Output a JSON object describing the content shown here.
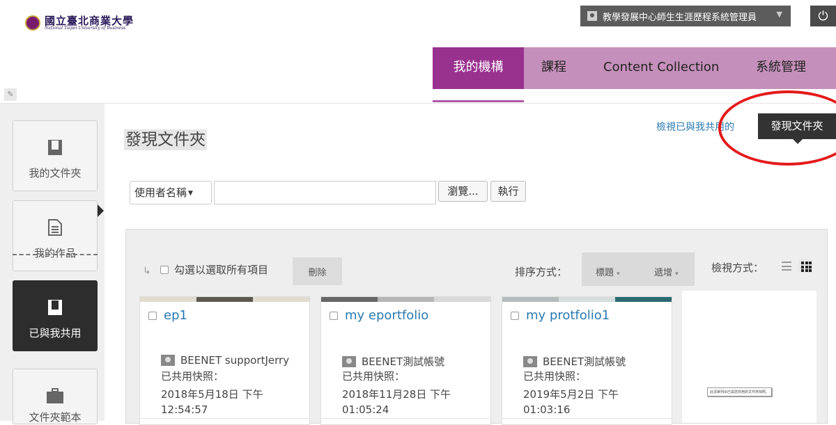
{
  "header": {
    "logo_cn": "國立臺北商業大學",
    "logo_en": "National Taipei University of Business",
    "user_name": "教學發展中心師生生涯歷程系統管理員"
  },
  "nav": {
    "tabs": [
      {
        "label": "我的機構"
      },
      {
        "label": "課程"
      },
      {
        "label": "Content Collection"
      },
      {
        "label": "系統管理"
      }
    ]
  },
  "sidebar": {
    "items": [
      {
        "label": "我的文件夾"
      },
      {
        "label": "我的作品"
      },
      {
        "label": "已與我共用"
      },
      {
        "label": "文件夾範本"
      }
    ]
  },
  "main": {
    "title": "發現文件夾",
    "shared_link": "檢視已與我共用的",
    "discover_button": "發現文件夾",
    "search_field": "使用者名稱",
    "search_value": "",
    "browse_button": "瀏覽...",
    "go_button": "執行"
  },
  "toolbar": {
    "select_all": "勾選以選取所有項目",
    "delete": "刪除",
    "sort_label": "排序方式：",
    "sort_by": "標題",
    "sort_order": "遞增",
    "view_label": "檢視方式："
  },
  "cards": [
    {
      "title": "ep1",
      "owner": "BEENET supportJerry",
      "snapshot_label": "已共用快照：",
      "date": "2018年5月18日 下午",
      "time": "12:54:57",
      "colors": [
        "#e0dccf",
        "#5c594f",
        "#e0dccf"
      ]
    },
    {
      "title": "my eportfolio",
      "owner": "BEENET測試帳號",
      "snapshot_label": "已共用快照：",
      "date": "2018年11月28日 下午",
      "time": "01:05:24",
      "colors": [
        "#666666",
        "#b5b5b5",
        "#d9d9d9"
      ]
    },
    {
      "title": "my protfolio1",
      "owner": "BEENET測試帳號",
      "snapshot_label": "已共用快照：",
      "date": "2019年5月2日 下午",
      "time": "01:03:16",
      "colors": [
        "#b3bcbc",
        "#d5dddd",
        "#2a6b70"
      ]
    }
  ],
  "side_note": "此清單列出已與您共用的文件夾快照。"
}
